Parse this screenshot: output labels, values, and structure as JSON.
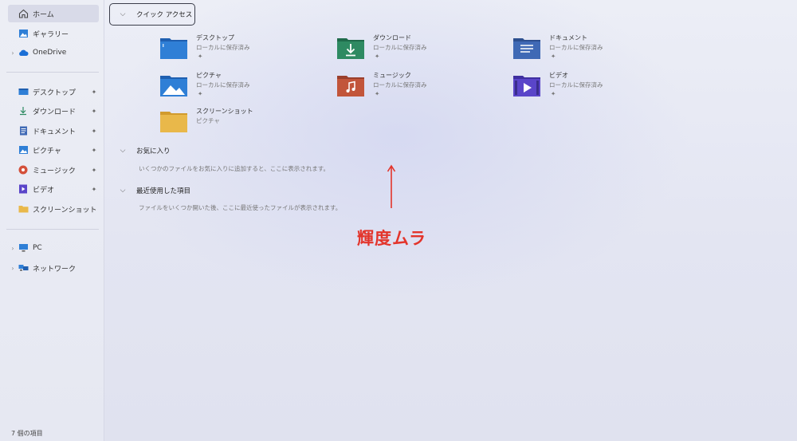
{
  "sidebar": {
    "items": [
      {
        "label": "ホーム",
        "icon": "home-icon"
      },
      {
        "label": "ギャラリー",
        "icon": "gallery-icon"
      },
      {
        "label": "OneDrive",
        "icon": "cloud-icon"
      }
    ],
    "pinned": [
      {
        "label": "デスクトップ",
        "icon": "desktop-icon",
        "pin": "✦"
      },
      {
        "label": "ダウンロード",
        "icon": "download-icon",
        "pin": "✦"
      },
      {
        "label": "ドキュメント",
        "icon": "document-icon",
        "pin": "✦"
      },
      {
        "label": "ピクチャ",
        "icon": "picture-icon",
        "pin": "✦"
      },
      {
        "label": "ミュージック",
        "icon": "music-icon",
        "pin": "✦"
      },
      {
        "label": "ビデオ",
        "icon": "video-icon",
        "pin": "✦"
      },
      {
        "label": "スクリーンショット",
        "icon": "folder-icon",
        "pin": ""
      }
    ],
    "system": [
      {
        "label": "PC",
        "icon": "pc-icon"
      },
      {
        "label": "ネットワーク",
        "icon": "network-icon"
      }
    ]
  },
  "quick_access": {
    "title": "クイック アクセス",
    "tiles": [
      {
        "name": "デスクトップ",
        "sub": "ローカルに保存済み",
        "pin": "✦",
        "icon": "desktop-folder-icon"
      },
      {
        "name": "ダウンロード",
        "sub": "ローカルに保存済み",
        "pin": "✦",
        "icon": "download-folder-icon"
      },
      {
        "name": "ドキュメント",
        "sub": "ローカルに保存済み",
        "pin": "✦",
        "icon": "document-folder-icon"
      },
      {
        "name": "ピクチャ",
        "sub": "ローカルに保存済み",
        "pin": "✦",
        "icon": "picture-folder-icon"
      },
      {
        "name": "ミュージック",
        "sub": "ローカルに保存済み",
        "pin": "✦",
        "icon": "music-folder-icon"
      },
      {
        "name": "ビデオ",
        "sub": "ローカルに保存済み",
        "pin": "✦",
        "icon": "video-folder-icon"
      },
      {
        "name": "スクリーンショット",
        "sub": "ピクチャ",
        "pin": "",
        "icon": "screenshot-folder-icon"
      }
    ]
  },
  "favorites": {
    "title": "お気に入り",
    "hint": "いくつかのファイルをお気に入りに追加すると、ここに表示されます。"
  },
  "recent": {
    "title": "最近使用した項目",
    "hint": "ファイルをいくつか開いた後、ここに最近使ったファイルが表示されます。"
  },
  "status_bar": {
    "count": "7 個の項目"
  },
  "annotation": {
    "text": "輝度ムラ",
    "color": "#e3342b"
  },
  "colors": {
    "blue_folder": "#2f7fd6",
    "green_folder": "#2e8a62",
    "doc_folder": "#3f69b5",
    "music_folder": "#c2553a",
    "video_folder": "#5a45c9",
    "yellow_folder": "#e9b84a"
  }
}
